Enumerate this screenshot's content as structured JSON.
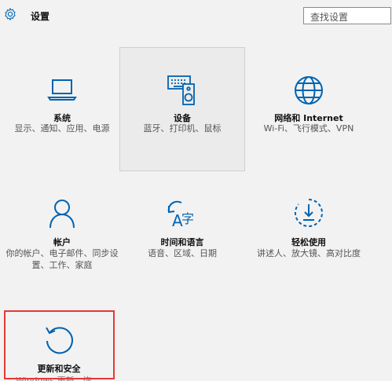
{
  "header": {
    "title": "设置",
    "search_placeholder": "查找设置",
    "icon": "gear-icon"
  },
  "tiles": [
    {
      "name": "系统",
      "desc": "显示、通知、应用、电源",
      "icon": "laptop-icon",
      "selected": false
    },
    {
      "name": "设备",
      "desc": "蓝牙、打印机、鼠标",
      "icon": "keyboard-speaker-icon",
      "selected": true
    },
    {
      "name": "网络和 Internet",
      "desc": "Wi-Fi、飞行模式、VPN",
      "icon": "globe-icon",
      "selected": false
    },
    {
      "name": "帐户",
      "desc": "你的帐户、电子邮件、同步设置、工作、家庭",
      "icon": "person-icon",
      "selected": false
    },
    {
      "name": "时间和语言",
      "desc": "语音、区域、日期",
      "icon": "time-language-icon",
      "selected": false
    },
    {
      "name": "轻松使用",
      "desc": "讲述人、放大镜、高对比度",
      "icon": "ease-of-access-icon",
      "selected": false
    },
    {
      "name": "更新和安全",
      "desc": "Windows 更新、恢",
      "icon": "refresh-icon",
      "selected": false
    }
  ],
  "colors": {
    "accent": "#0063b1",
    "highlight_border": "#e53935",
    "background": "#f2f2f2"
  }
}
